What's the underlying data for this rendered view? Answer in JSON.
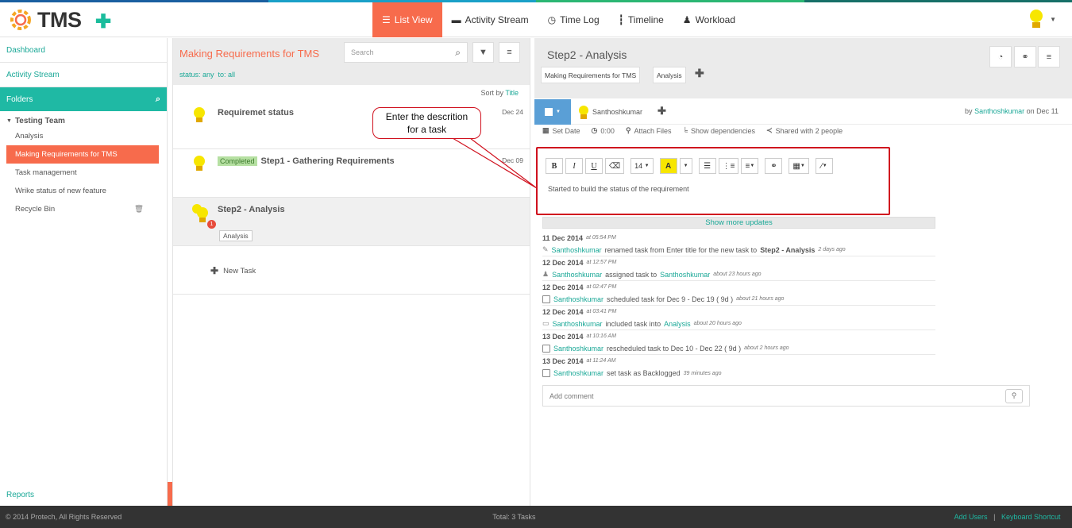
{
  "colors": {
    "accent": "#f76b4c",
    "teal": "#1fb9a4",
    "link": "#1aa897",
    "callout_border": "#d0111e",
    "strip": [
      "#1a5fa0",
      "#1aa0c8",
      "#2bb673",
      "#177068"
    ]
  },
  "header": {
    "logo_text": "TMS",
    "add_icon": "plus-icon",
    "nav": [
      {
        "label": "List View",
        "icon": "list-icon",
        "active": true
      },
      {
        "label": "Activity Stream",
        "icon": "comment-icon"
      },
      {
        "label": "Time Log",
        "icon": "clock-icon"
      },
      {
        "label": "Timeline",
        "icon": "timeline-icon"
      },
      {
        "label": "Workload",
        "icon": "user-icon"
      }
    ]
  },
  "sidebar": {
    "dashboard": "Dashboard",
    "activity": "Activity Stream",
    "folders": "Folders",
    "team": "Testing Team",
    "items": [
      {
        "label": "Analysis"
      },
      {
        "label": "Making Requirements for TMS",
        "active": true
      },
      {
        "label": "Task management"
      },
      {
        "label": "Wrike status of new feature"
      },
      {
        "label": "Recycle Bin",
        "icon": "trash-icon"
      }
    ],
    "reports": "Reports"
  },
  "list": {
    "title": "Making Requirements for TMS",
    "status_label": "status: any",
    "to_label": "to: all",
    "search_placeholder": "Search",
    "sort_prefix": "Sort by",
    "sort_field": "Title",
    "tasks": [
      {
        "title": "Requiremet status",
        "date": "Dec 24"
      },
      {
        "badge": "Completed",
        "title": "Step1 - Gathering Requirements",
        "date": "Dec 09"
      },
      {
        "title": "Step2 - Analysis",
        "tag": "Analysis",
        "count": "1"
      }
    ],
    "new_task": "New Task"
  },
  "detail": {
    "title": "Step2 - Analysis",
    "crumbs": [
      "Making Requirements for TMS",
      "Analysis"
    ],
    "assignee": "Santhoshkumar",
    "by_prefix": "by",
    "by_user": "Santhoshkumar",
    "by_suffix": "on Dec 11",
    "tools": [
      {
        "label": "Set Date",
        "icon": "calendar-icon"
      },
      {
        "label": "0:00",
        "icon": "clock-icon"
      },
      {
        "label": "Attach Files",
        "icon": "paperclip-icon"
      },
      {
        "label": "Show dependencies",
        "icon": "dependency-icon"
      },
      {
        "label": "Shared with 2 people",
        "icon": "share-icon"
      }
    ],
    "editor": {
      "font_size": "14",
      "text": "Started to build the status of the requirement"
    },
    "show_more": "Show more updates",
    "feed": [
      {
        "date": "11 Dec 2014",
        "time": "at 05:54 PM",
        "user": "Santhoshkumar",
        "text": "renamed task from Enter title for the new task to",
        "bold": "Step2 - Analysis",
        "ago": "2 days ago"
      },
      {
        "date": "12 Dec 2014",
        "time": "at 12:57 PM",
        "user": "Santhoshkumar",
        "text": "assigned task to",
        "link": "Santhoshkumar",
        "ago": "about 23 hours ago"
      },
      {
        "date": "12 Dec 2014",
        "time": "at 02:47 PM",
        "user": "Santhoshkumar",
        "text": "scheduled task for Dec 9 - Dec 19 ( 9d )",
        "ago": "about 21 hours ago"
      },
      {
        "date": "12 Dec 2014",
        "time": "at 03:41 PM",
        "user": "Santhoshkumar",
        "text": "included task into",
        "link": "Analysis",
        "ago": "about 20 hours ago"
      },
      {
        "date": "13 Dec 2014",
        "time": "at 10:16 AM",
        "user": "Santhoshkumar",
        "text": "rescheduled task to Dec 10 - Dec 22 ( 9d )",
        "ago": "about 2 hours ago"
      },
      {
        "date": "13 Dec 2014",
        "time": "at 11:24 AM",
        "user": "Santhoshkumar",
        "text": "set task as Backlogged",
        "ago": "39 minutes ago"
      }
    ],
    "comment_placeholder": "Add comment"
  },
  "callout": {
    "line1": "Enter the descrition",
    "line2": "for a task"
  },
  "footer": {
    "copyright": "© 2014 Protech, All Rights Reserved",
    "total": "Total: 3 Tasks",
    "add_users": "Add Users",
    "sep": "|",
    "shortcut": "Keyboard Shortcut"
  }
}
